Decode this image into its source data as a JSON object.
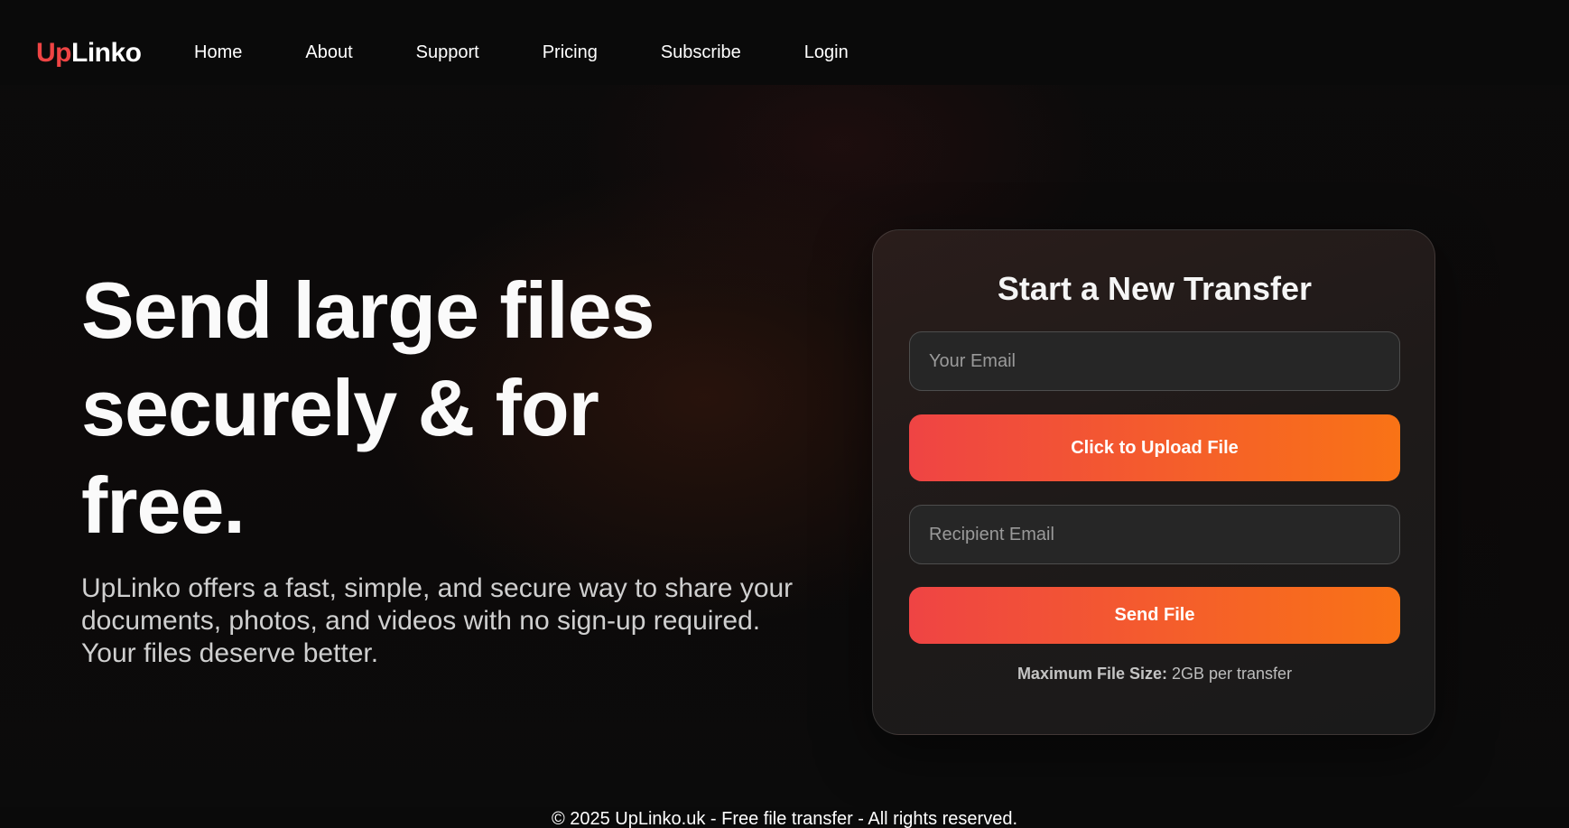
{
  "brand": {
    "logo_part1": "Up",
    "logo_part2": "Linko",
    "accent_color": "#ef4444",
    "gradient_end_color": "#f97316"
  },
  "nav": {
    "items": [
      {
        "label": "Home"
      },
      {
        "label": "About"
      },
      {
        "label": "Support"
      },
      {
        "label": "Pricing"
      },
      {
        "label": "Subscribe"
      },
      {
        "label": "Login"
      }
    ]
  },
  "hero": {
    "title_line1": "Send large files",
    "title_line2": "securely & for",
    "title_line3": "free.",
    "description": "UpLinko offers a fast, simple, and secure way to share your documents, photos, and videos with no sign-up required. Your files deserve better."
  },
  "transfer_card": {
    "title": "Start a New Transfer",
    "email_placeholder": "Your Email",
    "upload_label": "Click to Upload File",
    "recipient_placeholder": "Recipient Email",
    "send_label": "Send File",
    "max_size_label": "Maximum File Size:",
    "max_size_value": "2GB per transfer"
  },
  "footer": {
    "text": "© 2025 UpLinko.uk - Free file transfer - All rights reserved."
  }
}
